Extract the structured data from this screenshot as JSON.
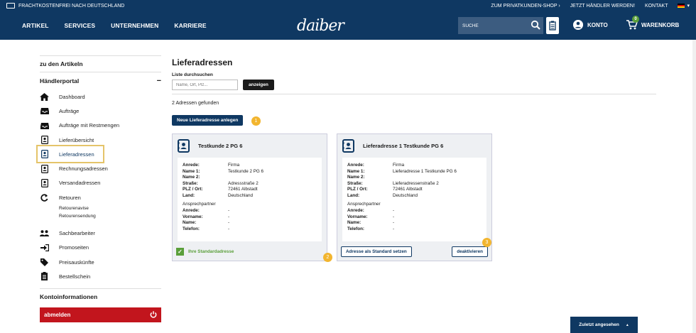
{
  "topbar": {
    "shipping": "FRACHTKOSTENFREI NACH DEUTSCHLAND",
    "links": [
      "ZUM PRIVATKUNDEN-SHOP ›",
      "JETZT HÄNDLER WERDEN!",
      "KONTAKT"
    ],
    "lang_arrow": "▾"
  },
  "nav": {
    "items": [
      "ARTIKEL",
      "SERVICES",
      "UNTERNEHMEN",
      "KARRIERE"
    ],
    "logo": "daiber",
    "search_placeholder": "SUCHE",
    "konto": "KONTO",
    "cart": "WARENKORB",
    "cart_count": "0"
  },
  "sidebar": {
    "back": "zu den Artikeln",
    "portal": "Händlerportal",
    "collapse": "−",
    "items": {
      "dashboard": "Dashboard",
      "auftraege": "Aufträge",
      "restmengen": "Aufträge mit Restmengen",
      "lieferuebersicht": "Lieferübersicht",
      "lieferadressen": "Lieferadressen",
      "rechnungsadressen": "Rechnungsadressen",
      "versandadressen": "Versandadressen",
      "retouren": "Retouren",
      "retourenavise": "Retourenavise",
      "retourensendung": "Retourensendung",
      "sachbearbeiter": "Sachbearbeiter",
      "promoseiten": "Promoseiten",
      "preisauskuenfte": "Preisauskünfte",
      "bestellschein": "Bestellschein"
    },
    "konto_info": "Kontoinformationen",
    "logout": "abmelden"
  },
  "main": {
    "title": "Lieferadressen",
    "search_label": "Liste durchsuchen",
    "search_placeholder": "Name, Ort, Plz...",
    "search_button": "anzeigen",
    "found": "2 Adressen gefunden",
    "new_button": "Neue Lieferadresse anlegen",
    "markers": [
      "1",
      "2",
      "3"
    ]
  },
  "labels": {
    "anrede": "Anrede:",
    "name1": "Name 1:",
    "name2": "Name 2:",
    "strasse": "Straße:",
    "plz": "PLZ / Ort:",
    "land": "Land:",
    "ansprech": "Ansprechpartner",
    "vorname": "Vorname:",
    "name": "Name:",
    "telefon": "Telefon:"
  },
  "cards": [
    {
      "title": "Testkunde 2 PG 6",
      "anrede": "Firma",
      "name1": "Testkunde 2 PG 6",
      "name2": "",
      "strasse": "Adressstraße 2",
      "plz": "72461 Albstadt",
      "land": "Deutschland",
      "c_anrede": "-",
      "c_vorname": "-",
      "c_name": "-",
      "c_telefon": "-",
      "standard": "Ihre Standardadresse"
    },
    {
      "title": "Lieferadresse 1 Testkunde PG 6",
      "anrede": "Firma",
      "name1": "Lieferadresse 1 Testkunde PG 6",
      "name2": "",
      "strasse": "Lieferadressenstraße 2",
      "plz": "72461 Albstadt",
      "land": "Deutschland",
      "c_anrede": "-",
      "c_vorname": "-",
      "c_name": "-",
      "c_telefon": "-",
      "set_standard": "Adresse als Standard setzen",
      "deactivate": "deaktivieren"
    }
  ],
  "recent": "Zuletzt angesehen",
  "recent_arrow": "▲",
  "colors": {
    "navy": "#0f3862",
    "red": "#c2151d",
    "green": "#5a9f3a",
    "marker": "#f2b52f"
  }
}
